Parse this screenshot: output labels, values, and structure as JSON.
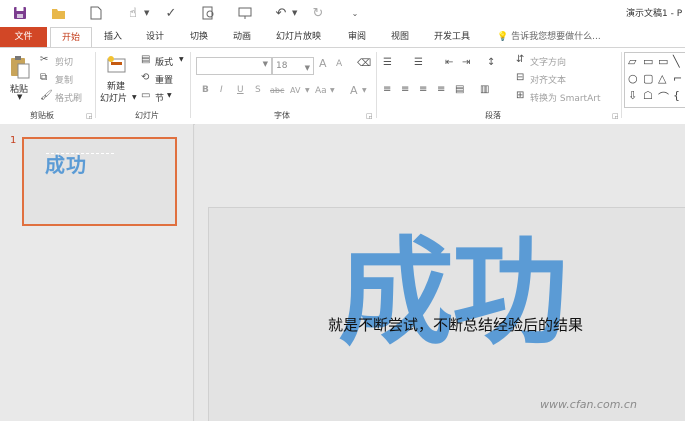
{
  "window": {
    "title": "演示文稿1 - P"
  },
  "tabs": [
    "文件",
    "开始",
    "插入",
    "设计",
    "切换",
    "动画",
    "幻灯片放映",
    "审阅",
    "视图",
    "开发工具"
  ],
  "tell_me": "告诉我您想要做什么...",
  "clipboard": {
    "paste": "粘贴",
    "cut": "剪切",
    "copy": "复制",
    "format_painter": "格式刷",
    "label": "剪贴板"
  },
  "slides_group": {
    "new_slide_1": "新建",
    "new_slide_2": "幻灯片",
    "layout": "版式",
    "reset": "重置",
    "section": "节",
    "label": "幻灯片"
  },
  "font": {
    "size": "18",
    "label": "字体",
    "bold": "B",
    "italic": "I",
    "underline": "U",
    "shadow": "S",
    "strike": "abc",
    "spacing": "AV",
    "case": "Aa",
    "color": "A",
    "grow": "A",
    "shrink": "A"
  },
  "paragraph": {
    "text_direction": "文字方向",
    "align_text": "对齐文本",
    "smartart": "转换为 SmartArt",
    "label": "段落"
  },
  "slide_panel": {
    "number": "1",
    "thumb_title": "成功"
  },
  "slide": {
    "title": "成功",
    "subtitle": "就是不断尝试，不断总结经验后的结果"
  },
  "watermark": "www.cfan.com.cn"
}
